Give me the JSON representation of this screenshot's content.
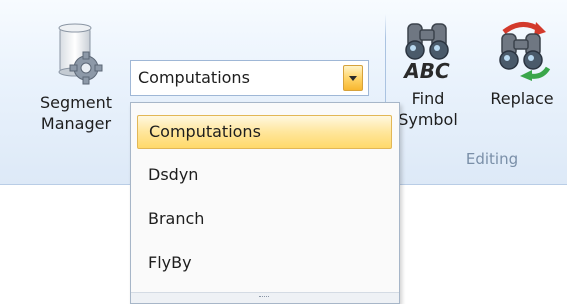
{
  "ribbon": {
    "segment_manager": {
      "line1": "Segment",
      "line2": "Manager",
      "icon": "gear-scroll-icon"
    },
    "combo": {
      "value": "Computations"
    },
    "find_symbol": {
      "line1": "Find",
      "line2": "Symbol",
      "icon": "binoculars-abc-icon"
    },
    "replace": {
      "label": "Replace",
      "icon": "binoculars-swap-icon"
    },
    "group_label": "Editing"
  },
  "dropdown": {
    "options": [
      {
        "label": "Computations",
        "selected": true
      },
      {
        "label": "Dsdyn",
        "selected": false
      },
      {
        "label": "Branch",
        "selected": false
      },
      {
        "label": "FlyBy",
        "selected": false
      }
    ]
  },
  "colors": {
    "ribbon_bg": "#e9f2fc",
    "selection_fill": "#ffe69c",
    "selection_border": "#e2b756",
    "group_label": "#7a8fa8"
  }
}
